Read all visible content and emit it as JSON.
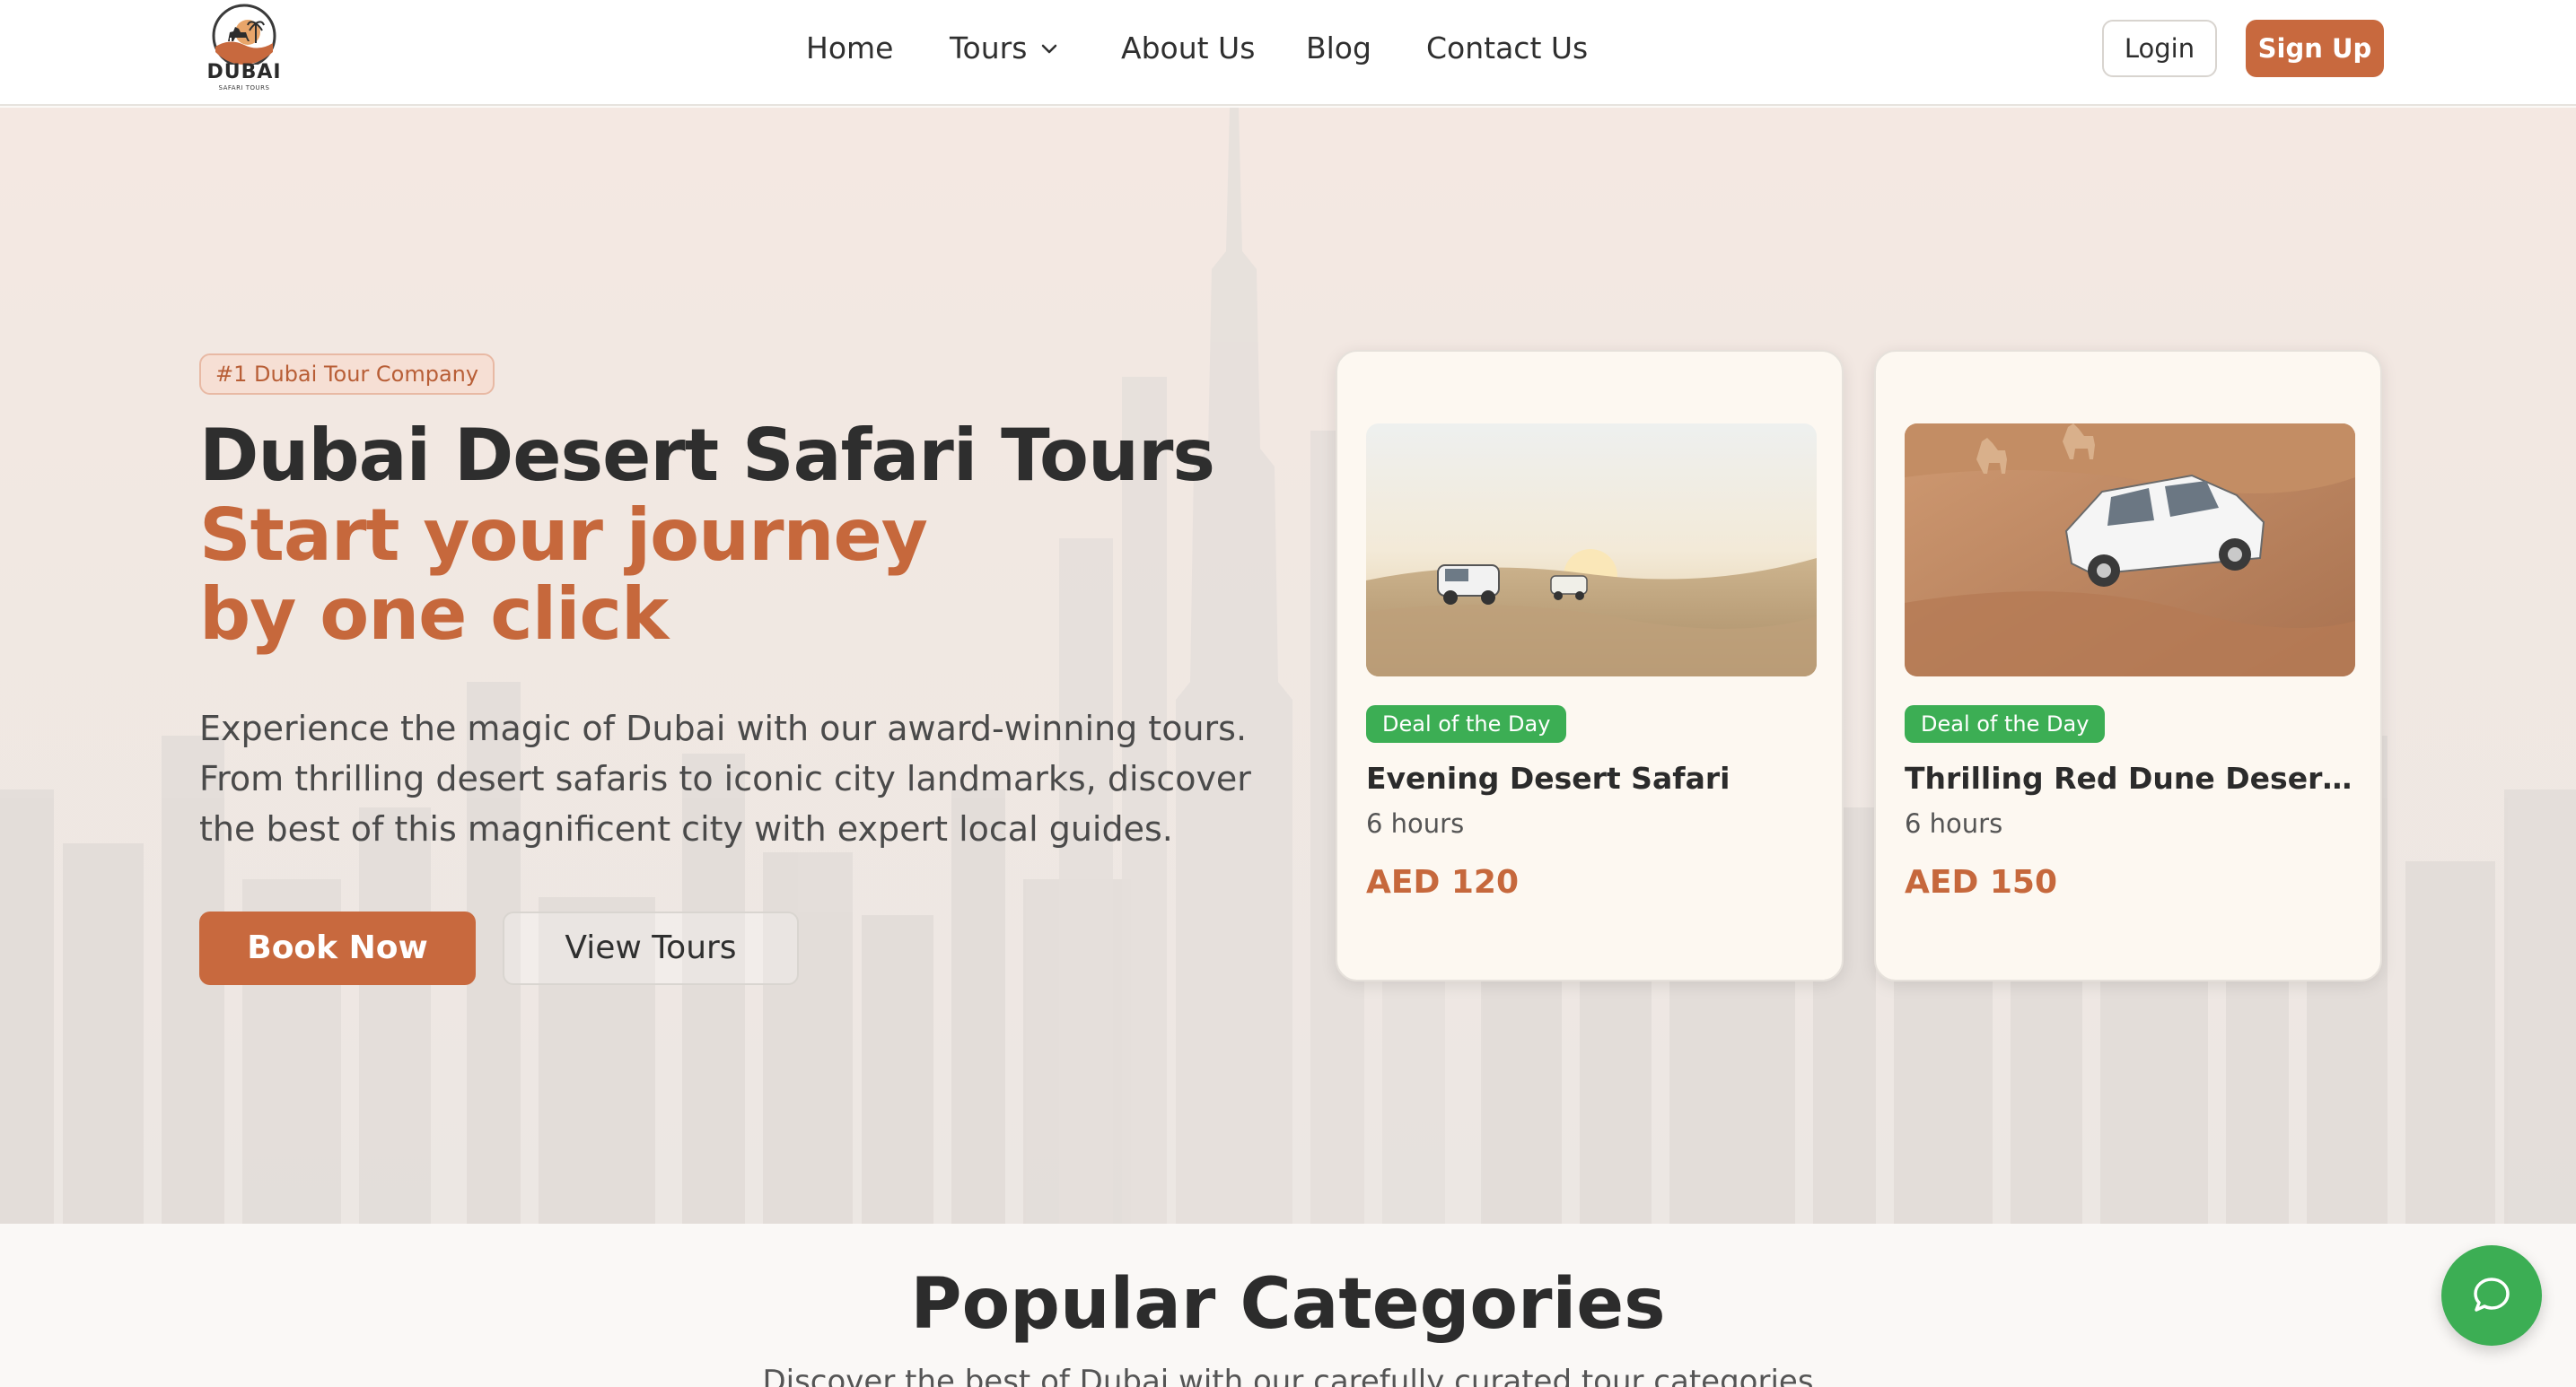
{
  "brand": {
    "name": "DUBAI",
    "tagline": "SAFARI TOURS",
    "logo_icon": "camel-sun-icon"
  },
  "nav": {
    "items": [
      {
        "label": "Home"
      },
      {
        "label": "Tours",
        "has_dropdown": true
      },
      {
        "label": "About Us"
      },
      {
        "label": "Blog"
      },
      {
        "label": "Contact Us"
      }
    ],
    "login_label": "Login",
    "signup_label": "Sign Up"
  },
  "hero": {
    "badge": "#1 Dubai Tour Company",
    "title": "Dubai Desert Safari Tours",
    "accent_line1": "Start your journey",
    "accent_line2": "by one click",
    "description": "Experience the magic of Dubai with our award-winning tours. From thrilling desert safaris to iconic city landmarks, discover the best of this magnificent city with expert local guides.",
    "book_label": "Book Now",
    "view_label": "View Tours"
  },
  "deals": [
    {
      "tag": "Deal of the Day",
      "title": "Evening Desert Safari",
      "duration": "6 hours",
      "price": "AED 120"
    },
    {
      "tag": "Deal of the Day",
      "title": "Thrilling Red Dune Desert...",
      "duration": "6 hours",
      "price": "AED 150"
    }
  ],
  "categories": {
    "title": "Popular Categories",
    "subtitle": "Discover the best of Dubai with our carefully curated tour categories"
  },
  "chat": {
    "icon": "chat-bubble-icon"
  },
  "colors": {
    "accent": "#c8693e",
    "success": "#3cae54",
    "text": "#2e2e2e"
  }
}
